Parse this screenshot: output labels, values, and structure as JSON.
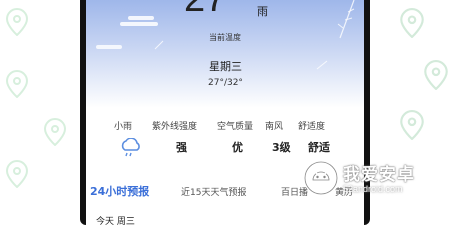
{
  "weather": {
    "temperature": "27",
    "condition": "雨",
    "temp_label": "当前温度",
    "weekday": "星期三",
    "range": "27°/32°"
  },
  "metrics": [
    {
      "label": "小雨",
      "value": "",
      "icon": "light-rain-icon"
    },
    {
      "label": "紫外线强度",
      "value": "强"
    },
    {
      "label": "空气质量",
      "value": "优"
    },
    {
      "label": "南风",
      "value": "3级"
    },
    {
      "label": "舒适度",
      "value": "舒适"
    }
  ],
  "tabs": [
    {
      "label": "24小时预报",
      "active": true
    },
    {
      "label": "近15天天气预报",
      "active": false
    },
    {
      "label": "百日播",
      "active": false
    },
    {
      "label": "黄历",
      "active": false
    }
  ],
  "bottom": {
    "label": "今天 周三"
  },
  "watermark": {
    "title": "我爱安卓",
    "url": "52android.com"
  },
  "colors": {
    "accent": "#3b6fd8",
    "sky_top": "#9fb7ea",
    "sky_mid": "#c9d6f3"
  }
}
